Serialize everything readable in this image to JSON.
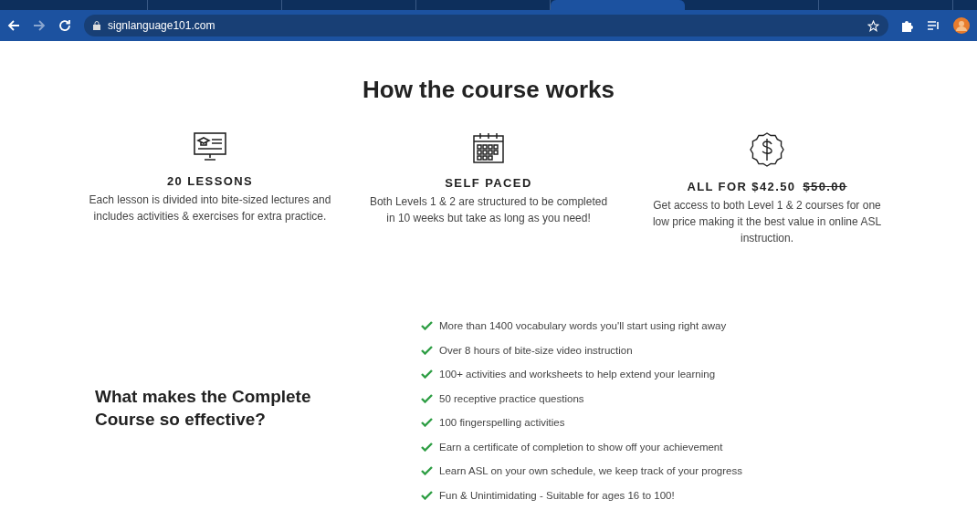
{
  "browser": {
    "tabs": [
      {
        "selected": false
      },
      {
        "selected": false
      },
      {
        "selected": false
      },
      {
        "selected": false
      },
      {
        "selected": true
      },
      {
        "selected": false
      },
      {
        "selected": false
      }
    ],
    "url": "signlanguage101.com"
  },
  "section_title": "How the course works",
  "features": [
    {
      "kind": "lessons",
      "title": "20 LESSONS",
      "text": "Each lesson is divided into bite-sized lectures and includes activities & exercises for extra practice."
    },
    {
      "kind": "calendar",
      "title": "SELF PACED",
      "text": "Both Levels 1 & 2 are structured to be completed in 10 weeks but take as long as you need!"
    },
    {
      "kind": "price",
      "title": "ALL FOR $42.50",
      "old_price": "$50.00",
      "text": "Get access to both Level 1 & 2 courses for one low price making it the best value in online ASL instruction."
    }
  ],
  "effective": {
    "heading": "What makes the Complete Course so effective?",
    "items": [
      "More than 1400 vocabulary words you'll start using right away",
      "Over 8 hours of bite-size video instruction",
      "100+ activities and worksheets to help extend your learning",
      "50 receptive practice questions",
      "100 fingerspelling activities",
      "Earn a certificate of completion to show off your achievement",
      "Learn ASL on your own schedule, we keep track of your progress",
      "Fun & Unintimidating - Suitable for ages 16 to 100!"
    ]
  }
}
